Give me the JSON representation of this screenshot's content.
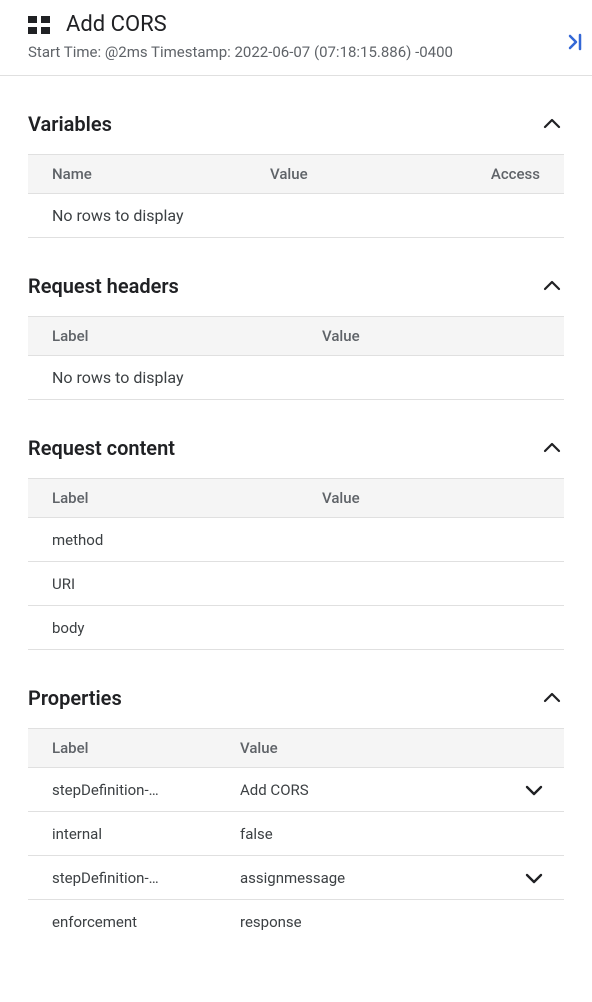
{
  "header": {
    "title": "Add CORS",
    "subtitle": "Start Time: @2ms Timestamp: 2022-06-07 (07:18:15.886) -0400"
  },
  "sections": {
    "variables": {
      "title": "Variables",
      "columns": {
        "name": "Name",
        "value": "Value",
        "access": "Access"
      },
      "empty": "No rows to display"
    },
    "request_headers": {
      "title": "Request headers",
      "columns": {
        "label": "Label",
        "value": "Value"
      },
      "empty": "No rows to display"
    },
    "request_content": {
      "title": "Request content",
      "columns": {
        "label": "Label",
        "value": "Value"
      },
      "rows": [
        {
          "label": "method",
          "value": ""
        },
        {
          "label": "URI",
          "value": ""
        },
        {
          "label": "body",
          "value": ""
        }
      ]
    },
    "properties": {
      "title": "Properties",
      "columns": {
        "label": "Label",
        "value": "Value"
      },
      "rows": [
        {
          "label": "stepDefinition-…",
          "value": "Add CORS",
          "expandable": true
        },
        {
          "label": "internal",
          "value": "false",
          "expandable": false
        },
        {
          "label": "stepDefinition-…",
          "value": "assignmessage",
          "expandable": true
        },
        {
          "label": "enforcement",
          "value": "response",
          "expandable": false
        }
      ]
    }
  }
}
